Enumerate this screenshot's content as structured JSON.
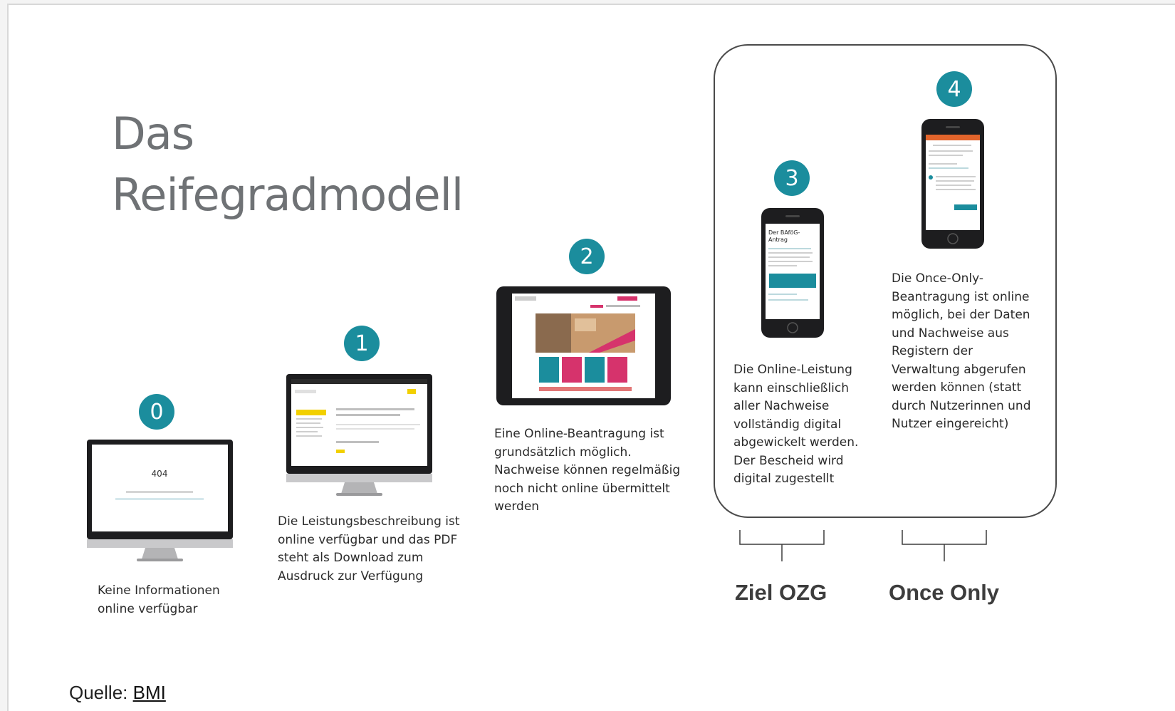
{
  "title": {
    "line1": "Das",
    "line2": "Reifegradmodell"
  },
  "levels": [
    {
      "badge": "0",
      "text": [
        "Keine Informationen",
        "online verfügbar"
      ],
      "device": "desktop",
      "screen_text": "404"
    },
    {
      "badge": "1",
      "text": [
        "Die Leistungsbeschreibung ist",
        "online verfügbar und das PDF",
        "steht als Download zum",
        "Ausdruck zur Verfügung"
      ],
      "device": "desktop"
    },
    {
      "badge": "2",
      "text": [
        "Eine Online-Beantragung ist",
        "grundsätzlich möglich.",
        "Nachweise können regelmäßig",
        "noch nicht online übermittelt",
        "werden"
      ],
      "device": "tablet"
    },
    {
      "badge": "3",
      "text": [
        "Die Online-Leistung",
        "kann einschließlich",
        "aller Nachweise",
        "vollständig digital",
        "abgewickelt werden.",
        "Der Bescheid wird",
        "digital zugestellt"
      ],
      "device": "phone",
      "screen_text": [
        "Der BAföG-",
        "Antrag"
      ]
    },
    {
      "badge": "4",
      "text": [
        "Die Once-Only-",
        "Beantragung ist online",
        "möglich, bei der Daten",
        "und Nachweise aus",
        "Registern der",
        "Verwaltung abgerufen",
        "werden können (statt",
        "durch Nutzerinnen und",
        "Nutzer eingereicht)"
      ],
      "device": "phone"
    }
  ],
  "brackets": [
    {
      "label": "Ziel OZG"
    },
    {
      "label": "Once Only"
    }
  ],
  "source": {
    "prefix": "Quelle: ",
    "link": "BMI"
  },
  "colors": {
    "badge": "#1b8d9d",
    "title": "#6f7275",
    "text": "#2b2b2b",
    "accent_pink": "#d6336c"
  }
}
